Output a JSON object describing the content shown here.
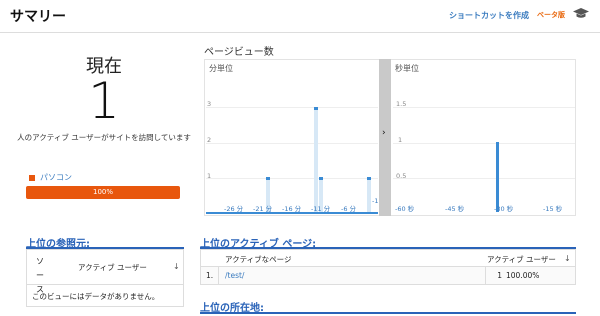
{
  "header": {
    "title": "サマリー",
    "shortcut_label": "ショートカットを作成",
    "beta_label": "ベータ版",
    "cap_icon": "graduation-cap-icon"
  },
  "now": {
    "label": "現在",
    "value": "1",
    "description": "人のアクティブ ユーザーがサイトを訪問しています",
    "device": {
      "name": "パソコン",
      "percent_label": "100%",
      "fraction": 1.0,
      "color": "#e8570d"
    }
  },
  "pageviews": {
    "title": "ページビュー数",
    "per_minute": {
      "label": "分単位",
      "y_ticks": [
        "3",
        "2",
        "1"
      ],
      "x_ticks": [
        "-26 分",
        "-21 分",
        "-16 分",
        "-11 分",
        "-6 分",
        "-1"
      ]
    },
    "per_second": {
      "label": "秒単位",
      "y_ticks": [
        "1.5",
        "1",
        "0.5"
      ],
      "x_ticks": [
        "-60 秒",
        "-45 秒",
        "-30 秒",
        "-15 秒"
      ]
    },
    "expand_icon": "chevron-right-icon"
  },
  "referrals": {
    "title": "上位の参照元:",
    "col_source": "ソース",
    "col_active_users": "アクティブ ユーザー",
    "sort_icon": "arrow-down-icon",
    "empty_message": "このビューにはデータがありません。"
  },
  "active_pages": {
    "title": "上位のアクティブ ページ:",
    "col_page": "アクティブなページ",
    "col_users": "アクティブ ユーザー",
    "sort_icon": "arrow-down-icon",
    "rows": [
      {
        "index": "1.",
        "page": "/test/",
        "users": "1",
        "percent": "100.00%"
      }
    ]
  },
  "locations": {
    "title": "上位の所在地:"
  },
  "colors": {
    "accent_blue": "#2a63b8",
    "chart_blue": "#3a8bd4",
    "beta_orange": "#e8650a"
  },
  "chart_data": [
    {
      "type": "bar",
      "title": "",
      "xlabel": "分単位",
      "ylabel": "",
      "x": [
        -30,
        -29,
        -28,
        -27,
        -26,
        -25,
        -24,
        -23,
        -22,
        -21,
        -20,
        -19,
        -18,
        -17,
        -16,
        -15,
        -14,
        -13,
        -12,
        -11,
        -10,
        -9,
        -8,
        -7,
        -6,
        -5,
        -4,
        -3,
        -2,
        -1
      ],
      "values": [
        0,
        0,
        0,
        0,
        0,
        0,
        0,
        0,
        0,
        0,
        1,
        0,
        0,
        0,
        0,
        0,
        0,
        0,
        0,
        3,
        1,
        0,
        0,
        0,
        0,
        0,
        0,
        0,
        0,
        1
      ],
      "ylim": [
        0,
        3
      ]
    },
    {
      "type": "bar",
      "title": "",
      "xlabel": "秒単位",
      "ylabel": "",
      "x": [
        -30
      ],
      "values": [
        1
      ],
      "ylim": [
        0,
        1.5
      ]
    }
  ]
}
